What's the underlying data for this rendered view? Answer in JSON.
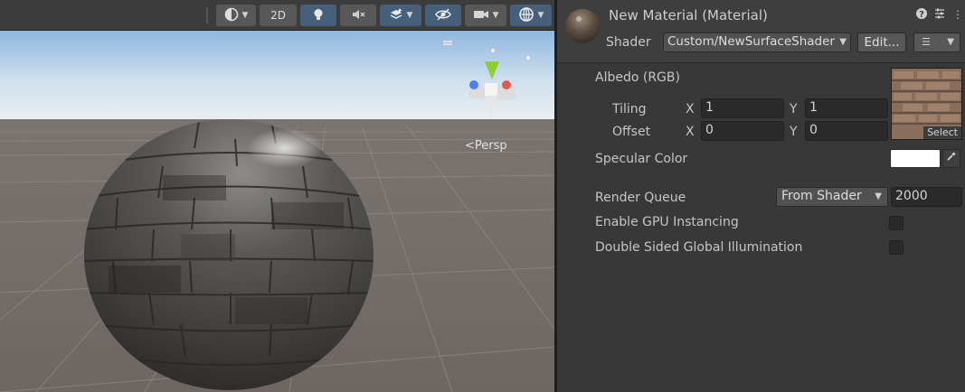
{
  "scene_toolbar": {
    "buttons": [
      {
        "id": "shading",
        "icon": "shading-mode-icon",
        "has_dropdown": true,
        "active": false
      },
      {
        "id": "2d",
        "label": "2D",
        "active": false
      },
      {
        "id": "lighting",
        "icon": "lightbulb-icon",
        "active": true
      },
      {
        "id": "audio",
        "icon": "audio-mute-icon",
        "active": false
      },
      {
        "id": "effects",
        "icon": "effects-layers-icon",
        "has_dropdown": true,
        "active": true
      },
      {
        "id": "visibility",
        "icon": "hidden-eye-icon",
        "active": true
      },
      {
        "id": "camera",
        "icon": "camera-icon",
        "has_dropdown": true,
        "active": false
      },
      {
        "id": "gizmos",
        "icon": "gizmos-globe-icon",
        "has_dropdown": true,
        "active": true
      }
    ]
  },
  "scene_view": {
    "projection_label": "Persp",
    "orientation_gizmo": {
      "y_color": "#8ed12f",
      "x_color": "#e05a4f",
      "z_color": "#4b7ff0"
    }
  },
  "inspector": {
    "title": "New Material (Material)",
    "header_icons": [
      "help-icon",
      "presets-icon",
      "more-menu-icon"
    ],
    "shader_label": "Shader",
    "shader_value": "Custom/NewSurfaceShader",
    "edit_label": "Edit...",
    "list_icon": "list-menu-icon",
    "albedo_label": "Albedo (RGB)",
    "texture_select_label": "Select",
    "tiling": {
      "label": "Tiling",
      "x_label": "X",
      "x": "1",
      "y_label": "Y",
      "y": "1"
    },
    "offset": {
      "label": "Offset",
      "x_label": "X",
      "x": "0",
      "y_label": "Y",
      "y": "0"
    },
    "specular": {
      "label": "Specular Color",
      "color": "#ffffff",
      "picker_icon": "eyedropper-icon"
    },
    "render_queue": {
      "label": "Render Queue",
      "mode": "From Shader",
      "value": "2000"
    },
    "gpu_instancing": {
      "label": "Enable GPU Instancing",
      "checked": false
    },
    "double_sided_gi": {
      "label": "Double Sided Global Illumination",
      "checked": false
    }
  },
  "colors": {
    "accent_active": "#46607c",
    "panel": "#383838",
    "field": "#2a2a2a"
  }
}
